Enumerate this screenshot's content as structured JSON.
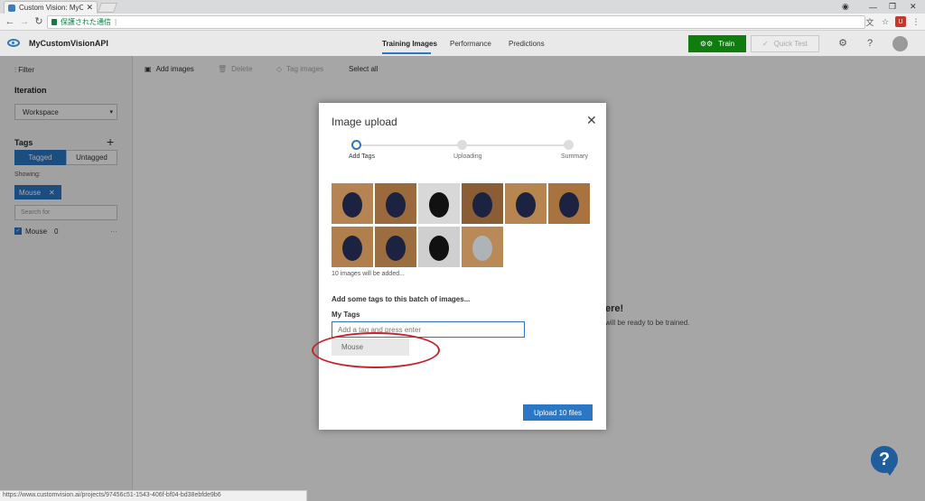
{
  "browser": {
    "tab_title": "Custom Vision: MyCusto",
    "address_text": "保護された通信",
    "minimize": "—",
    "maximize": "❐",
    "close": "✕"
  },
  "header": {
    "project_name": "MyCustomVisionAPI",
    "tabs": [
      {
        "label": "Training Images",
        "active": true
      },
      {
        "label": "Performance",
        "active": false
      },
      {
        "label": "Predictions",
        "active": false
      }
    ],
    "train_label": "Train",
    "quick_test_label": "Quick Test"
  },
  "sidebar": {
    "filter_label": "Filter",
    "iteration_title": "Iteration",
    "iteration_value": "Workspace",
    "tags_title": "Tags",
    "tagged_label": "Tagged",
    "untagged_label": "Untagged",
    "showing_label": "Showing:",
    "active_chip": "Mouse",
    "search_placeholder": "Search for",
    "tag_list": [
      {
        "name": "Mouse",
        "count": "0"
      }
    ]
  },
  "toolbar": {
    "add_images": "Add images",
    "delete": "Delete",
    "tag_images": "Tag images",
    "select_all": "Select all"
  },
  "background_main": {
    "title_fragment": "ere!",
    "subtitle_fragment": "will be ready to be trained."
  },
  "dialog": {
    "title": "Image upload",
    "steps": [
      {
        "label": "Add Tags",
        "active": true
      },
      {
        "label": "Uploading",
        "active": false
      },
      {
        "label": "Summary",
        "active": false
      }
    ],
    "image_count_text": "10 images will be added...",
    "add_tags_hint": "Add some tags to this batch of images...",
    "my_tags_label": "My Tags",
    "tag_input_placeholder": "Add a tag and press enter",
    "suggestion": "Mouse",
    "upload_label": "Upload 10 files"
  },
  "help": {
    "label": "?"
  },
  "status_url": "https://www.customvision.ai/projects/97456c51-1543-406f-bf04-bd38ebfde9b6",
  "colors": {
    "accent": "#2b77c5",
    "train_green": "#107c10",
    "annotation_red": "#c6232d"
  }
}
